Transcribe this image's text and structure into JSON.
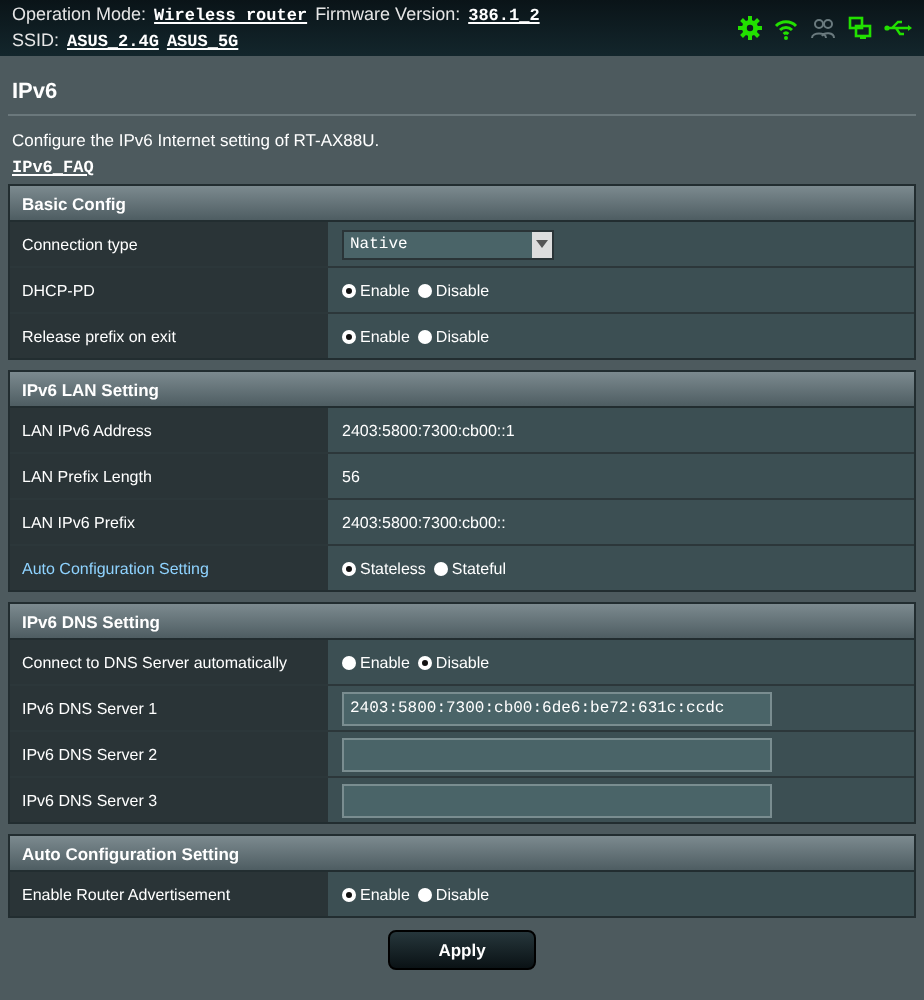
{
  "top_bar": {
    "operation_mode_label": "Operation Mode:",
    "operation_mode": "Wireless router",
    "firmware_label": "Firmware Version:",
    "firmware": "386.1_2",
    "ssid_label": "SSID:",
    "ssids": [
      "ASUS_2.4G",
      "ASUS_5G"
    ],
    "status_icons": [
      {
        "kind": "gear",
        "active": true
      },
      {
        "kind": "wifi",
        "active": true
      },
      {
        "kind": "people",
        "active": false
      },
      {
        "kind": "monitors",
        "active": true
      },
      {
        "kind": "usb",
        "active": true
      }
    ]
  },
  "page": {
    "title": "IPv6",
    "description": "Configure the IPv6 Internet setting of RT-AX88U.",
    "faq_link": "IPv6_FAQ"
  },
  "sections": [
    {
      "title": "Basic Config",
      "rows": [
        {
          "kind": "select",
          "label": "Connection type",
          "value": "Native"
        },
        {
          "kind": "radio",
          "label": "DHCP-PD",
          "options": [
            {
              "label": "Enable",
              "selected": true
            },
            {
              "label": "Disable",
              "selected": false
            }
          ]
        },
        {
          "kind": "radio",
          "label": "Release prefix on exit",
          "options": [
            {
              "label": "Enable",
              "selected": true
            },
            {
              "label": "Disable",
              "selected": false
            }
          ]
        }
      ]
    },
    {
      "title": "IPv6 LAN Setting",
      "rows": [
        {
          "kind": "text",
          "label": "LAN IPv6 Address",
          "value": "2403:5800:7300:cb00::1"
        },
        {
          "kind": "text",
          "label": "LAN Prefix Length",
          "value": "56"
        },
        {
          "kind": "text",
          "label": "LAN IPv6 Prefix",
          "value": "2403:5800:7300:cb00::"
        },
        {
          "kind": "radio",
          "label": "Auto Configuration Setting",
          "highlighted": true,
          "options": [
            {
              "label": "Stateless",
              "selected": true
            },
            {
              "label": "Stateful",
              "selected": false
            }
          ]
        }
      ]
    },
    {
      "title": "IPv6 DNS Setting",
      "rows": [
        {
          "kind": "radio",
          "label": "Connect to DNS Server automatically",
          "options": [
            {
              "label": "Enable",
              "selected": false
            },
            {
              "label": "Disable",
              "selected": true
            }
          ]
        },
        {
          "kind": "input",
          "label": "IPv6 DNS Server 1",
          "value": "2403:5800:7300:cb00:6de6:be72:631c:ccdc"
        },
        {
          "kind": "input",
          "label": "IPv6 DNS Server 2"
        },
        {
          "kind": "input",
          "label": "IPv6 DNS Server 3"
        }
      ]
    },
    {
      "title": "Auto Configuration Setting",
      "rows": [
        {
          "kind": "radio",
          "label": "Enable Router Advertisement",
          "options": [
            {
              "label": "Enable",
              "selected": true
            },
            {
              "label": "Disable",
              "selected": false
            }
          ]
        }
      ]
    }
  ],
  "apply_button": "Apply"
}
